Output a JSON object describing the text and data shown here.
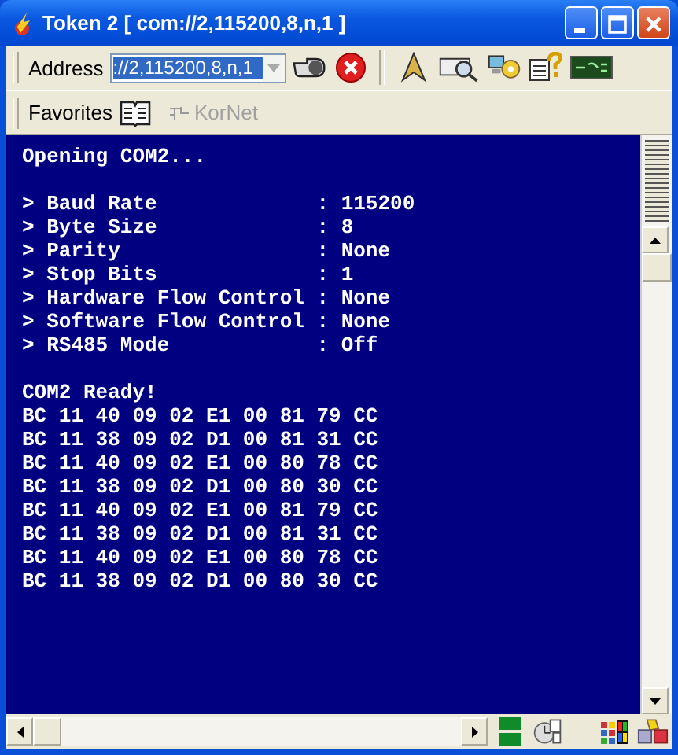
{
  "window": {
    "title": "Token 2 [ com://2,115200,8,n,1 ]"
  },
  "address_bar": {
    "label": "Address",
    "value": "://2,115200,8,n,1"
  },
  "favorites_bar": {
    "label": "Favorites",
    "link": "KorNet"
  },
  "terminal": {
    "blocks": [
      [
        "Opening COM2..."
      ],
      [
        "> Baud Rate             : 115200",
        "> Byte Size             : 8",
        "> Parity                : None",
        "> Stop Bits             : 1",
        "> Hardware Flow Control : None",
        "> Software Flow Control : None",
        "> RS485 Mode            : Off"
      ],
      [
        "COM2 Ready!",
        "BC 11 40 09 02 E1 00 81 79 CC",
        "BC 11 38 09 02 D1 00 81 31 CC",
        "BC 11 40 09 02 E1 00 80 78 CC",
        "BC 11 38 09 02 D1 00 80 30 CC",
        "BC 11 40 09 02 E1 00 81 79 CC",
        "BC 11 38 09 02 D1 00 81 31 CC",
        "BC 11 40 09 02 E1 00 80 78 CC",
        "BC 11 38 09 02 D1 00 80 30 CC"
      ]
    ]
  }
}
